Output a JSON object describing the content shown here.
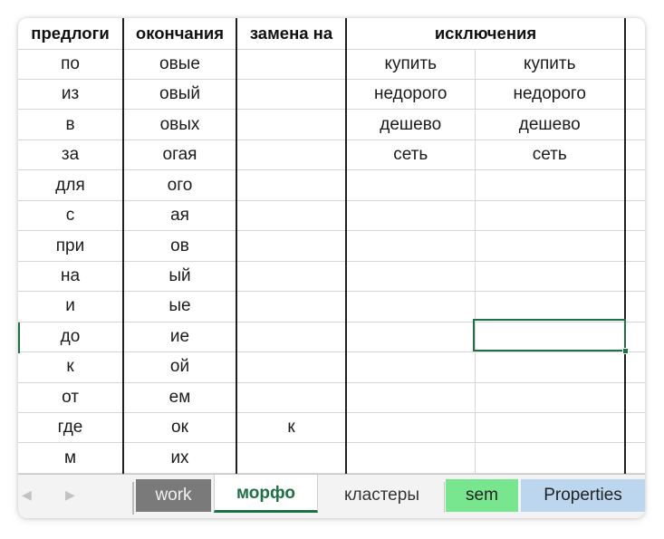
{
  "sheet": {
    "headers": [
      "предлоги",
      "окончания",
      "замена на",
      "исключения"
    ],
    "rows": [
      [
        "по",
        "овые",
        "",
        "купить",
        "купить"
      ],
      [
        "из",
        "овый",
        "",
        "недорого",
        "недорого"
      ],
      [
        "в",
        "овых",
        "",
        "дешево",
        "дешево"
      ],
      [
        "за",
        "огая",
        "",
        "сеть",
        "сеть"
      ],
      [
        "для",
        "ого",
        "",
        "",
        ""
      ],
      [
        "с",
        "ая",
        "",
        "",
        ""
      ],
      [
        "при",
        "ов",
        "",
        "",
        ""
      ],
      [
        "на",
        "ый",
        "",
        "",
        ""
      ],
      [
        "и",
        "ые",
        "",
        "",
        ""
      ],
      [
        "до",
        "ие",
        "",
        "",
        ""
      ],
      [
        "к",
        "ой",
        "",
        "",
        ""
      ],
      [
        "от",
        "ем",
        "",
        "",
        ""
      ],
      [
        "где",
        "ок",
        "к",
        "",
        ""
      ],
      [
        "м",
        "их",
        "",
        "",
        ""
      ]
    ],
    "selected_cell": {
      "row": 10,
      "col": 5
    }
  },
  "tabs": {
    "prev_glyph": "◀",
    "next_glyph": "▶",
    "items": [
      {
        "label": "work",
        "color": "#7a7a7a",
        "active": false
      },
      {
        "label": "морфо",
        "color": "#ffffff",
        "active": true
      },
      {
        "label": "кластеры",
        "color": "#f3f3f3",
        "active": false
      },
      {
        "label": "sem",
        "color": "#78e58f",
        "active": false
      },
      {
        "label": "Properties",
        "color": "#bcd6ef",
        "active": false
      }
    ]
  },
  "colors": {
    "accent": "#1e7145",
    "gridline": "#d6d6d6",
    "thick_border": "#202020"
  }
}
